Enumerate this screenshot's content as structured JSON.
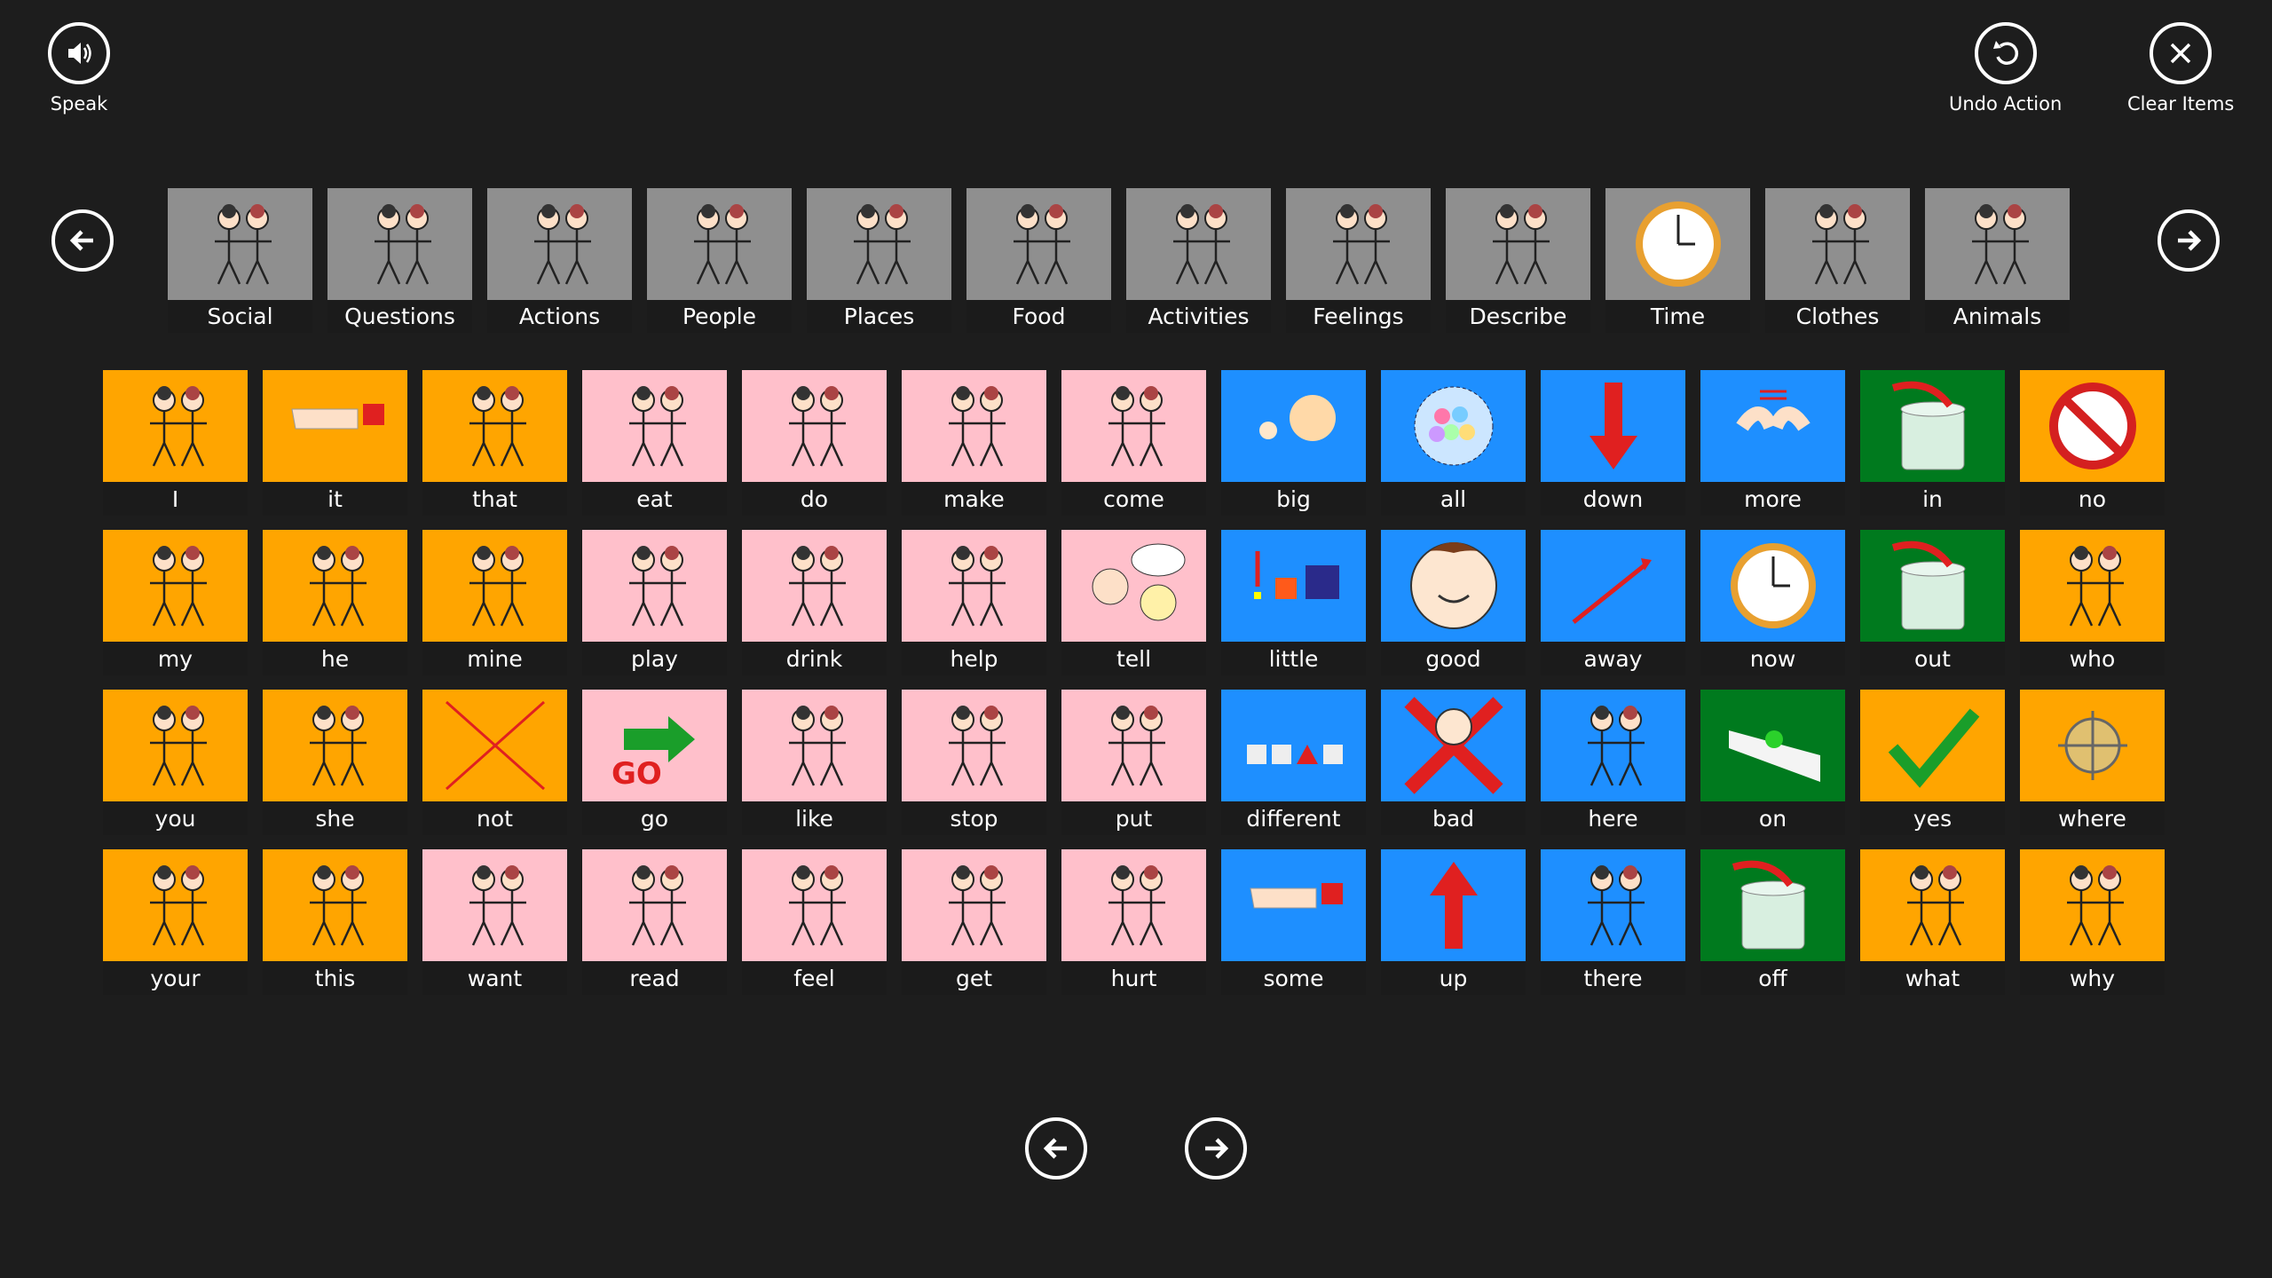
{
  "toolbar": {
    "speak_label": "Speak",
    "undo_label": "Undo Action",
    "clear_label": "Clear Items"
  },
  "categories": [
    {
      "label": "Social",
      "icon": "two-people-icon"
    },
    {
      "label": "Questions",
      "icon": "question-people-icon"
    },
    {
      "label": "Actions",
      "icon": "running-person-icon"
    },
    {
      "label": "People",
      "icon": "faces-group-icon"
    },
    {
      "label": "Places",
      "icon": "map-icon"
    },
    {
      "label": "Food",
      "icon": "food-icon"
    },
    {
      "label": "Activities",
      "icon": "activities-icon"
    },
    {
      "label": "Feelings",
      "icon": "emotion-faces-icon"
    },
    {
      "label": "Describe",
      "icon": "describe-icon"
    },
    {
      "label": "Time",
      "icon": "clock-icon"
    },
    {
      "label": "Clothes",
      "icon": "clothes-icon"
    },
    {
      "label": "Animals",
      "icon": "animals-icon"
    }
  ],
  "colors": {
    "orange": "#ffa500",
    "pink": "#ffc0cb",
    "blue": "#1e8fff",
    "green": "#007a1e",
    "caption": "#1b1b1b",
    "background": "#1d1d1d"
  },
  "words": [
    [
      {
        "label": "I",
        "color": "orange",
        "icon": "stick-person-icon"
      },
      {
        "label": "it",
        "color": "orange",
        "icon": "pointing-hand-icon"
      },
      {
        "label": "that",
        "color": "orange",
        "icon": "person-pointing-icon"
      },
      {
        "label": "eat",
        "color": "pink",
        "icon": "eating-person-icon"
      },
      {
        "label": "do",
        "color": "pink",
        "icon": "hands-icon"
      },
      {
        "label": "make",
        "color": "pink",
        "icon": "person-table-icon"
      },
      {
        "label": "come",
        "color": "pink",
        "icon": "come-arrow-icon"
      },
      {
        "label": "big",
        "color": "blue",
        "icon": "big-ball-icon"
      },
      {
        "label": "all",
        "color": "blue",
        "icon": "all-balls-icon"
      },
      {
        "label": "down",
        "color": "blue",
        "icon": "down-arrow-icon"
      },
      {
        "label": "more",
        "color": "blue",
        "icon": "more-hands-icon"
      },
      {
        "label": "in",
        "color": "green",
        "icon": "pot-in-icon"
      },
      {
        "label": "no",
        "color": "orange",
        "icon": "no-sign-icon"
      }
    ],
    [
      {
        "label": "my",
        "color": "orange",
        "icon": "girl-icon"
      },
      {
        "label": "he",
        "color": "orange",
        "icon": "two-people-icon"
      },
      {
        "label": "mine",
        "color": "orange",
        "icon": "person-ball-icon"
      },
      {
        "label": "play",
        "color": "pink",
        "icon": "playing-people-icon"
      },
      {
        "label": "drink",
        "color": "pink",
        "icon": "drinking-person-icon"
      },
      {
        "label": "help",
        "color": "pink",
        "icon": "helping-hands-icon"
      },
      {
        "label": "tell",
        "color": "pink",
        "icon": "speech-bubble-icon"
      },
      {
        "label": "little",
        "color": "blue",
        "icon": "little-squares-icon"
      },
      {
        "label": "good",
        "color": "blue",
        "icon": "happy-face-icon"
      },
      {
        "label": "away",
        "color": "blue",
        "icon": "away-arrow-icon"
      },
      {
        "label": "now",
        "color": "blue",
        "icon": "clock-icon"
      },
      {
        "label": "out",
        "color": "green",
        "icon": "pot-out-icon"
      },
      {
        "label": "who",
        "color": "orange",
        "icon": "question-person-icon"
      }
    ],
    [
      {
        "label": "you",
        "color": "orange",
        "icon": "two-people-icon"
      },
      {
        "label": "she",
        "color": "orange",
        "icon": "two-people-icon"
      },
      {
        "label": "not",
        "color": "orange",
        "icon": "red-cross-icon"
      },
      {
        "label": "go",
        "color": "pink",
        "icon": "go-arrow-icon"
      },
      {
        "label": "like",
        "color": "pink",
        "icon": "like-person-icon"
      },
      {
        "label": "stop",
        "color": "pink",
        "icon": "stop-hand-icon"
      },
      {
        "label": "put",
        "color": "pink",
        "icon": "put-box-icon"
      },
      {
        "label": "different",
        "color": "blue",
        "icon": "shapes-icon"
      },
      {
        "label": "bad",
        "color": "blue",
        "icon": "bad-face-icon"
      },
      {
        "label": "here",
        "color": "blue",
        "icon": "person-here-icon"
      },
      {
        "label": "on",
        "color": "green",
        "icon": "ball-on-icon"
      },
      {
        "label": "yes",
        "color": "orange",
        "icon": "checkmark-icon"
      },
      {
        "label": "where",
        "color": "orange",
        "icon": "compass-icon"
      }
    ],
    [
      {
        "label": "your",
        "color": "orange",
        "icon": "giving-box-icon"
      },
      {
        "label": "this",
        "color": "orange",
        "icon": "person-ball-icon"
      },
      {
        "label": "want",
        "color": "pink",
        "icon": "reaching-hands-icon"
      },
      {
        "label": "read",
        "color": "pink",
        "icon": "reading-person-icon"
      },
      {
        "label": "feel",
        "color": "pink",
        "icon": "feeling-person-icon"
      },
      {
        "label": "get",
        "color": "pink",
        "icon": "getting-person-icon"
      },
      {
        "label": "hurt",
        "color": "pink",
        "icon": "hurt-face-icon"
      },
      {
        "label": "some",
        "color": "blue",
        "icon": "pinching-hand-icon"
      },
      {
        "label": "up",
        "color": "blue",
        "icon": "up-arrow-icon"
      },
      {
        "label": "there",
        "color": "blue",
        "icon": "person-pointing-icon"
      },
      {
        "label": "off",
        "color": "green",
        "icon": "pot-off-icon"
      },
      {
        "label": "what",
        "color": "orange",
        "icon": "thinking-face-icon"
      },
      {
        "label": "why",
        "color": "orange",
        "icon": "question-face-icon"
      }
    ]
  ]
}
